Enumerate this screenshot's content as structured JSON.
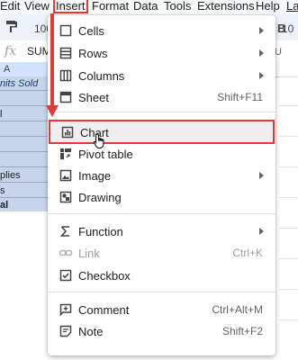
{
  "menubar": {
    "items": [
      "Edit",
      "View",
      "Insert",
      "Format",
      "Data",
      "Tools",
      "Extensions",
      "Help",
      "La"
    ],
    "active": "Insert"
  },
  "toolbar": {
    "zoom_partial": "100",
    "font_size_partial": "10",
    "bold": "B"
  },
  "formula_bar": {
    "cell_ref": "SUM",
    "fx": "fx",
    "content_partial": "U"
  },
  "grid": {
    "column_header": "A",
    "cells": [
      "nits Sold",
      "l",
      "",
      "",
      "",
      "plies",
      "s",
      "al"
    ]
  },
  "menu": {
    "items": [
      {
        "label": "Cells",
        "icon": "cells-icon",
        "submenu": true
      },
      {
        "label": "Rows",
        "icon": "rows-icon",
        "submenu": true
      },
      {
        "label": "Columns",
        "icon": "columns-icon",
        "submenu": true
      },
      {
        "label": "Sheet",
        "icon": "sheet-icon",
        "shortcut": "Shift+F11"
      },
      {
        "label": "Chart",
        "icon": "chart-icon",
        "highlighted": true
      },
      {
        "label": "Pivot table",
        "icon": "pivot-table-icon"
      },
      {
        "label": "Image",
        "icon": "image-icon",
        "submenu": true
      },
      {
        "label": "Drawing",
        "icon": "drawing-icon"
      },
      {
        "label": "Function",
        "icon": "sigma-icon",
        "submenu": true
      },
      {
        "label": "Link",
        "icon": "link-icon",
        "shortcut": "Ctrl+K",
        "disabled": true
      },
      {
        "label": "Checkbox",
        "icon": "checkbox-icon"
      },
      {
        "label": "Comment",
        "icon": "comment-icon",
        "shortcut": "Ctrl+Alt+M"
      },
      {
        "label": "Note",
        "icon": "note-icon",
        "shortcut": "Shift+F2"
      }
    ]
  },
  "colors": {
    "highlight": "#e53935",
    "selection": "#c6d5ea"
  }
}
